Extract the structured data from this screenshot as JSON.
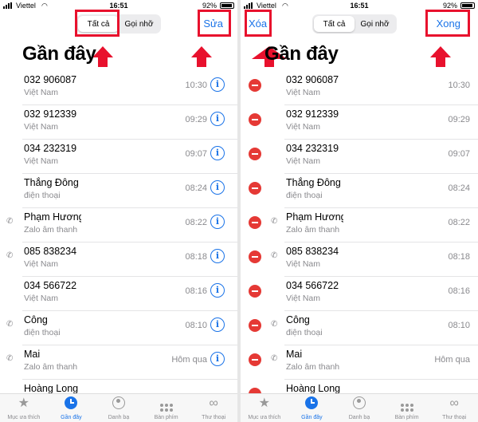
{
  "status_bar": {
    "carrier": "Viettel",
    "time": "16:51",
    "battery": "92%"
  },
  "segment": {
    "all": "Tất cả",
    "missed": "Gọi nhỡ"
  },
  "nav": {
    "edit": "Sửa",
    "done": "Xong",
    "clear": "Xóa"
  },
  "title": "Gần đây",
  "calls": [
    {
      "name": "032 906087",
      "sub": "Việt Nam",
      "time": "10:30",
      "icon": ""
    },
    {
      "name": "032 912339",
      "sub": "Việt Nam",
      "time": "09:29",
      "icon": ""
    },
    {
      "name": "034 232319",
      "sub": "Việt Nam",
      "time": "09:07",
      "icon": ""
    },
    {
      "name": "Thắng Đông",
      "sub": "điện thoại",
      "time": "08:24",
      "icon": ""
    },
    {
      "name": "Phạm Hương",
      "sub": "Zalo âm thanh",
      "time": "08:22",
      "icon": "phone-outgoing-icon"
    },
    {
      "name": "085 838234",
      "sub": "Việt Nam",
      "time": "08:18",
      "icon": "phone-outgoing-icon"
    },
    {
      "name": "034 566722",
      "sub": "Việt Nam",
      "time": "08:16",
      "icon": ""
    },
    {
      "name": "Công",
      "sub": "điện thoại",
      "time": "08:10",
      "icon": "phone-outgoing-icon"
    },
    {
      "name": "Mai",
      "sub": "Zalo âm thanh",
      "time": "Hôm qua",
      "icon": "phone-outgoing-icon"
    },
    {
      "name": "Hoàng Long",
      "sub": "",
      "time": "",
      "icon": ""
    }
  ],
  "tabs": [
    {
      "label": "Mục ưa thích",
      "icon": "star-icon"
    },
    {
      "label": "Gần đây",
      "icon": "clock-icon"
    },
    {
      "label": "Danh bạ",
      "icon": "contact-icon"
    },
    {
      "label": "Bàn phím",
      "icon": "keypad-icon"
    },
    {
      "label": "Thư thoại",
      "icon": "voicemail-icon"
    }
  ],
  "colors": {
    "accent": "#1a73e8",
    "highlight": "#e8112d",
    "delete": "#e53935"
  }
}
